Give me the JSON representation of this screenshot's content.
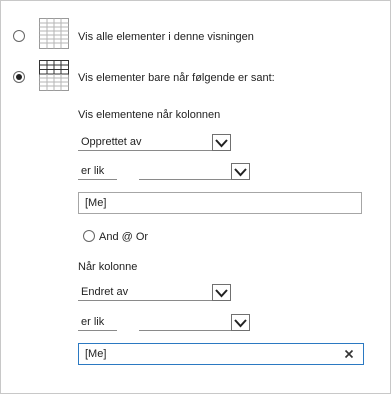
{
  "filter_options": {
    "show_all": {
      "label": "Vis alle elementer i denne visningen",
      "selected": false,
      "icon": "table-grid-icon"
    },
    "show_filtered": {
      "label": "Vis elementer bare når følgende er sant:",
      "selected": true,
      "icon": "filtered-table-icon"
    }
  },
  "condition_1": {
    "heading": "Vis elementene når kolonnen",
    "column_value": "Opprettet av",
    "operator_value": "er lik",
    "value": "[Me]"
  },
  "join": {
    "label": "And @ Or",
    "selected": false
  },
  "condition_2": {
    "heading": "Når kolonne",
    "column_value": "Endret av",
    "operator_value": "er lik",
    "value": "[Me]",
    "clear_icon": "close-icon"
  },
  "colors": {
    "border": "#c8c8c8",
    "focus": "#2b79c2",
    "icon_blue": "#dce9f5",
    "text": "#1f1f1f"
  }
}
